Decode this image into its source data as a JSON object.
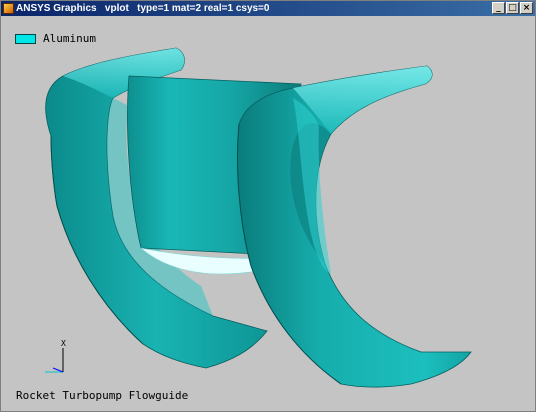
{
  "window": {
    "title": "ANSYS Graphics   vplot   type=1 mat=2 real=1 csys=0",
    "buttons": {
      "minimize": "_",
      "maximize": "□",
      "close": "×"
    }
  },
  "legend": {
    "swatch_color": "#00e5e5",
    "label": "Aluminum"
  },
  "caption": "Rocket Turbopump Flowguide",
  "triad": {
    "axis_label": "X"
  },
  "colors": {
    "background": "#c4c4c4",
    "model_fill": "#12a8a8",
    "model_highlight": "#5fe0e0",
    "model_shadow": "#0b6f70"
  }
}
